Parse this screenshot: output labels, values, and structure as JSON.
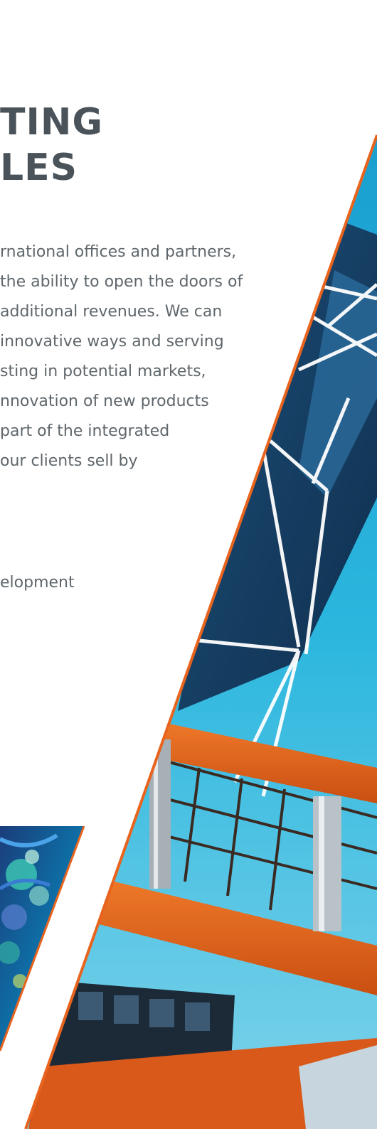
{
  "heading": {
    "line1": "TING",
    "line2": "LES"
  },
  "body": {
    "lines": [
      "rnational offices and partners,",
      "the ability to open the doors of",
      "additional revenues. We can",
      " innovative ways and serving",
      "sting in potential markets,",
      "nnovation of new products",
      " part of the integrated",
      " our clients sell by"
    ]
  },
  "extra": {
    "line": "elopment"
  },
  "colors": {
    "heading": "#4a5359",
    "body_text": "#5f676c",
    "accent_orange": "#e8641e",
    "sky_blue": "#1fb0dc"
  }
}
